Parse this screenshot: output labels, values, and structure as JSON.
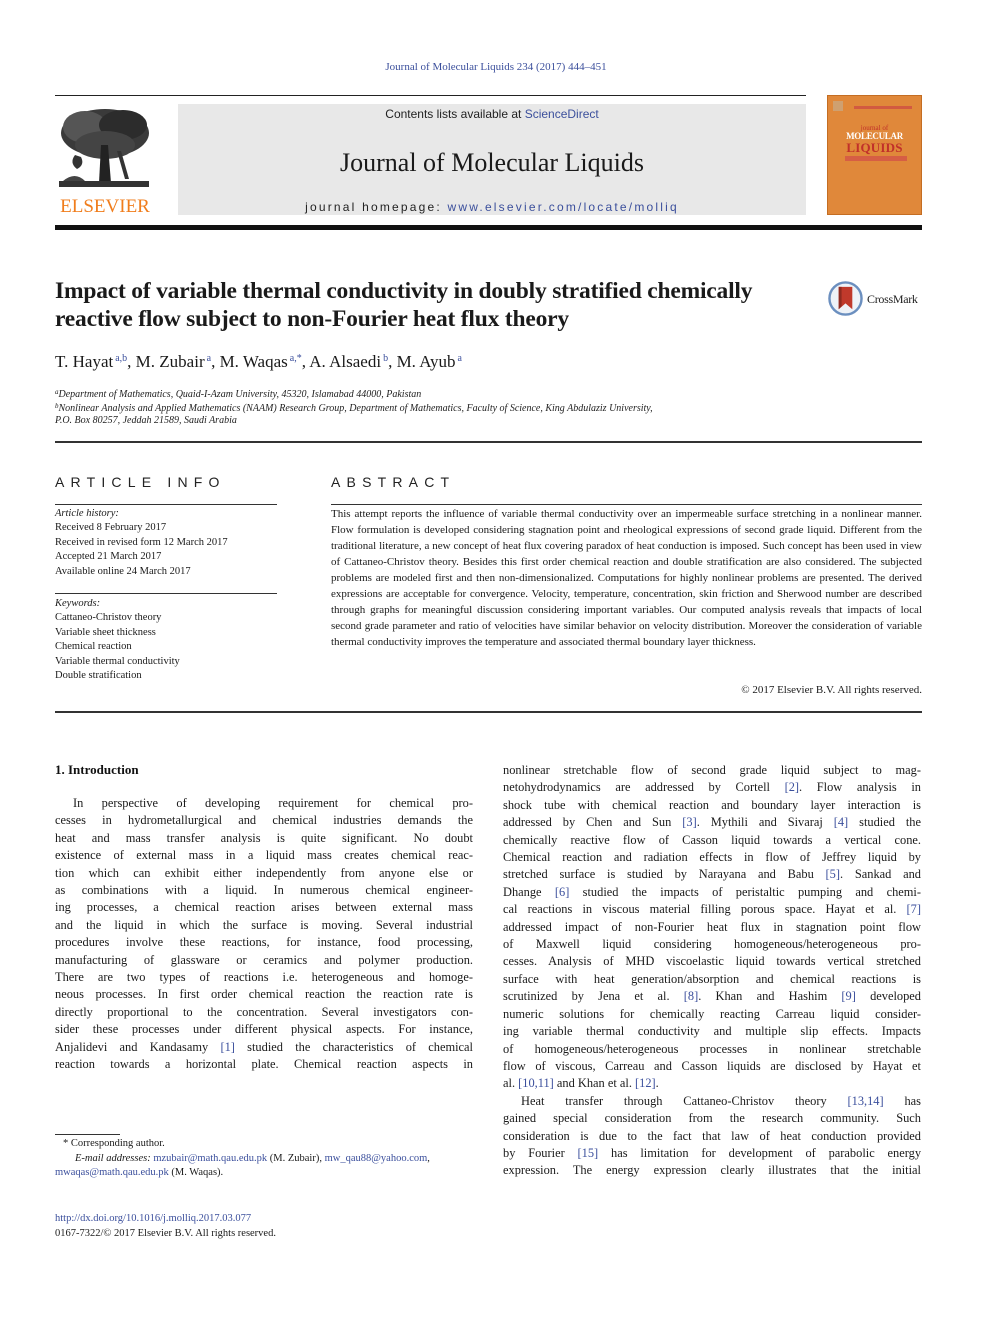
{
  "running_head": "Journal of Molecular Liquids 234 (2017) 444–451",
  "masthead": {
    "publisher_logo_text": "ELSEVIER",
    "contents_prefix": "Contents lists available at ",
    "contents_link": "ScienceDirect",
    "journal_title": "Journal of Molecular Liquids",
    "homepage_prefix": "journal homepage: ",
    "homepage_link": "www.elsevier.com/locate/molliq",
    "cover": {
      "small": "journal of",
      "line1": "MOLECULAR",
      "line2": "LIQUIDS"
    },
    "colors": {
      "elsevier_orange": "#f07d1c",
      "cover_orange": "#e0883a",
      "link_blue": "#3b4f9c",
      "banner_gray": "#e8e8e8"
    }
  },
  "article": {
    "title_line1": "Impact of variable thermal conductivity in doubly stratified chemically",
    "title_line2": "reactive flow subject to non-Fourier heat flux theory",
    "crossmark_label": "CrossMark",
    "authors": [
      {
        "name": "T. Hayat",
        "sup": "a,b",
        "sep": ", "
      },
      {
        "name": "M. Zubair",
        "sup": "a",
        "sep": ", "
      },
      {
        "name": "M. Waqas",
        "sup": "a,*",
        "sep": ", "
      },
      {
        "name": "A. Alsaedi",
        "sup": "b",
        "sep": ", "
      },
      {
        "name": "M. Ayub",
        "sup": "a",
        "sep": ""
      }
    ],
    "affiliations": [
      {
        "sup": "a",
        "text": "Department of Mathematics, Quaid-I-Azam University, 45320, Islamabad 44000, Pakistan"
      },
      {
        "sup": "b",
        "text": "Nonlinear Analysis and Applied Mathematics (NAAM) Research Group, Department of Mathematics, Faculty of Science, King Abdulaziz University,"
      },
      {
        "sup": "",
        "text": "P.O. Box 80257, Jeddah 21589, Saudi Arabia"
      }
    ]
  },
  "article_info": {
    "heading": "ARTICLE INFO",
    "history_label": "Article history:",
    "history": [
      "Received 8 February 2017",
      "Received in revised form 12 March 2017",
      "Accepted 21 March 2017",
      "Available online 24 March 2017"
    ],
    "keywords_label": "Keywords:",
    "keywords": [
      "Cattaneo-Christov theory",
      "Variable sheet thickness",
      "Chemical reaction",
      "Variable thermal conductivity",
      "Double stratification"
    ]
  },
  "abstract": {
    "heading": "ABSTRACT",
    "text": "This attempt reports the influence of variable thermal conductivity over an impermeable surface stretching in a nonlinear manner. Flow formulation is developed considering stagnation point and rheological expressions of second grade liquid. Different from the traditional literature, a new concept of heat flux covering paradox of heat conduction is imposed. Such concept has been used in view of Cattaneo-Christov theory. Besides this first order chemical reaction and double stratification are also considered. The subjected problems are modeled first and then non-dimensionalized. Computations for highly nonlinear problems are presented. The derived expressions are acceptable for convergence. Velocity, temperature, concentration, skin friction and Sherwood number are described through graphs for meaningful discussion considering important variables. Our computed analysis reveals that impacts of local second grade parameter and ratio of velocities have similar behavior on velocity distribution. Moreover the consideration of variable thermal conductivity improves the temperature and associated thermal boundary layer thickness.",
    "copyright": "© 2017 Elsevier B.V. All rights reserved."
  },
  "body": {
    "section_heading": "1.  Introduction",
    "left_lines": [
      {
        "t": "In perspective of developing requirement for chemical pro-",
        "indent": true
      },
      {
        "t": "cesses in hydrometallurgical and chemical industries demands the"
      },
      {
        "t": "heat and mass transfer analysis is quite significant. No doubt"
      },
      {
        "t": "existence of external mass in a liquid mass creates chemical reac-"
      },
      {
        "t": "tion which can exhibit either independently from anyone else or"
      },
      {
        "t": "as combinations with a liquid. In numerous chemical engineer-"
      },
      {
        "t": "ing processes, a chemical reaction arises between external mass"
      },
      {
        "t": "and the liquid in which the surface is moving. Several industrial"
      },
      {
        "t": "procedures involve these reactions, for instance, food processing,"
      },
      {
        "t": "manufacturing of glassware or ceramics and polymer production."
      },
      {
        "t": "There are two types of reactions i.e. heterogeneous and homoge-"
      },
      {
        "t": "neous processes. In first order chemical reaction the reaction rate is"
      },
      {
        "t": "directly proportional to the concentration. Several investigators con-"
      },
      {
        "t": "sider these processes under different physical aspects. For instance,"
      },
      {
        "pre": "Anjalidevi and Kandasamy ",
        "ref": "[1]",
        "post": " studied the characteristics of chemical"
      },
      {
        "t": "reaction towards a horizontal plate. Chemical reaction aspects in"
      }
    ],
    "right_lines": [
      {
        "t": "nonlinear stretchable flow of second grade liquid subject to mag-"
      },
      {
        "pre": "netohydrodynamics are addressed by Cortell ",
        "ref": "[2]",
        "post": ". Flow analysis in"
      },
      {
        "t": "shock tube with chemical reaction and boundary layer interaction is"
      },
      {
        "pre": "addressed by Chen and Sun ",
        "ref": "[3]",
        "mid": ". Mythili and Sivaraj ",
        "ref2": "[4]",
        "post": " studied the"
      },
      {
        "t": "chemically reactive flow of Casson liquid towards a vertical cone."
      },
      {
        "t": "Chemical reaction and radiation effects in flow of Jeffrey liquid by"
      },
      {
        "pre": "stretched surface is studied by Narayana and Babu ",
        "ref": "[5]",
        "post": ". Sankad and"
      },
      {
        "pre": "Dhange ",
        "ref": "[6]",
        "post": " studied the impacts of peristaltic pumping and chemi-"
      },
      {
        "pre": "cal reactions in viscous material filling porous space. Hayat et al. ",
        "ref": "[7]",
        "post": ""
      },
      {
        "t": "addressed impact of non-Fourier heat flux in stagnation point flow"
      },
      {
        "t": "of Maxwell liquid considering homogeneous/heterogeneous pro-"
      },
      {
        "t": "cesses. Analysis of MHD viscoelastic liquid towards vertical stretched"
      },
      {
        "t": "surface with heat generation/absorption and chemical reactions is"
      },
      {
        "pre": "scrutinized by Jena et al. ",
        "ref": "[8]",
        "mid": ". Khan and Hashim ",
        "ref2": "[9]",
        "post": " developed"
      },
      {
        "t": "numeric solutions for chemically reacting Carreau liquid consider-"
      },
      {
        "t": "ing variable thermal conductivity and multiple slip effects. Impacts"
      },
      {
        "t": "of homogeneous/heterogeneous processes in nonlinear stretchable"
      },
      {
        "t": "flow of viscous, Carreau and Casson liquids are disclosed by Hayat et"
      },
      {
        "pre": "al. ",
        "ref": "[10,11]",
        "mid": " and Khan et al. ",
        "ref2": "[12]",
        "post": ".",
        "last": true
      },
      {
        "pre": "Heat transfer through Cattaneo-Christov theory ",
        "ref": "[13,14]",
        "post": " has",
        "indent": true
      },
      {
        "t": "gained special consideration from the research community. Such"
      },
      {
        "t": "consideration is due to the fact that law of heat conduction provided"
      },
      {
        "pre": "by Fourier ",
        "ref": "[15]",
        "post": " has limitation for development of parabolic energy"
      },
      {
        "t": "expression. The energy expression clearly illustrates that the initial"
      }
    ]
  },
  "footnotes": {
    "corresponding_marker": "*",
    "corresponding_text": "Corresponding author.",
    "email_label": "E-mail addresses:",
    "emails": [
      {
        "email": "mzubair@math.qau.edu.pk",
        "owner": " (M. Zubair), "
      },
      {
        "email": "mw_qau88@yahoo.com",
        "owner": ","
      },
      {
        "email": "mwaqas@math.qau.edu.pk",
        "owner": " (M. Waqas)."
      }
    ],
    "doi": "http://dx.doi.org/10.1016/j.molliq.2017.03.077",
    "issn_copyright": "0167-7322/© 2017 Elsevier B.V. All rights reserved."
  }
}
